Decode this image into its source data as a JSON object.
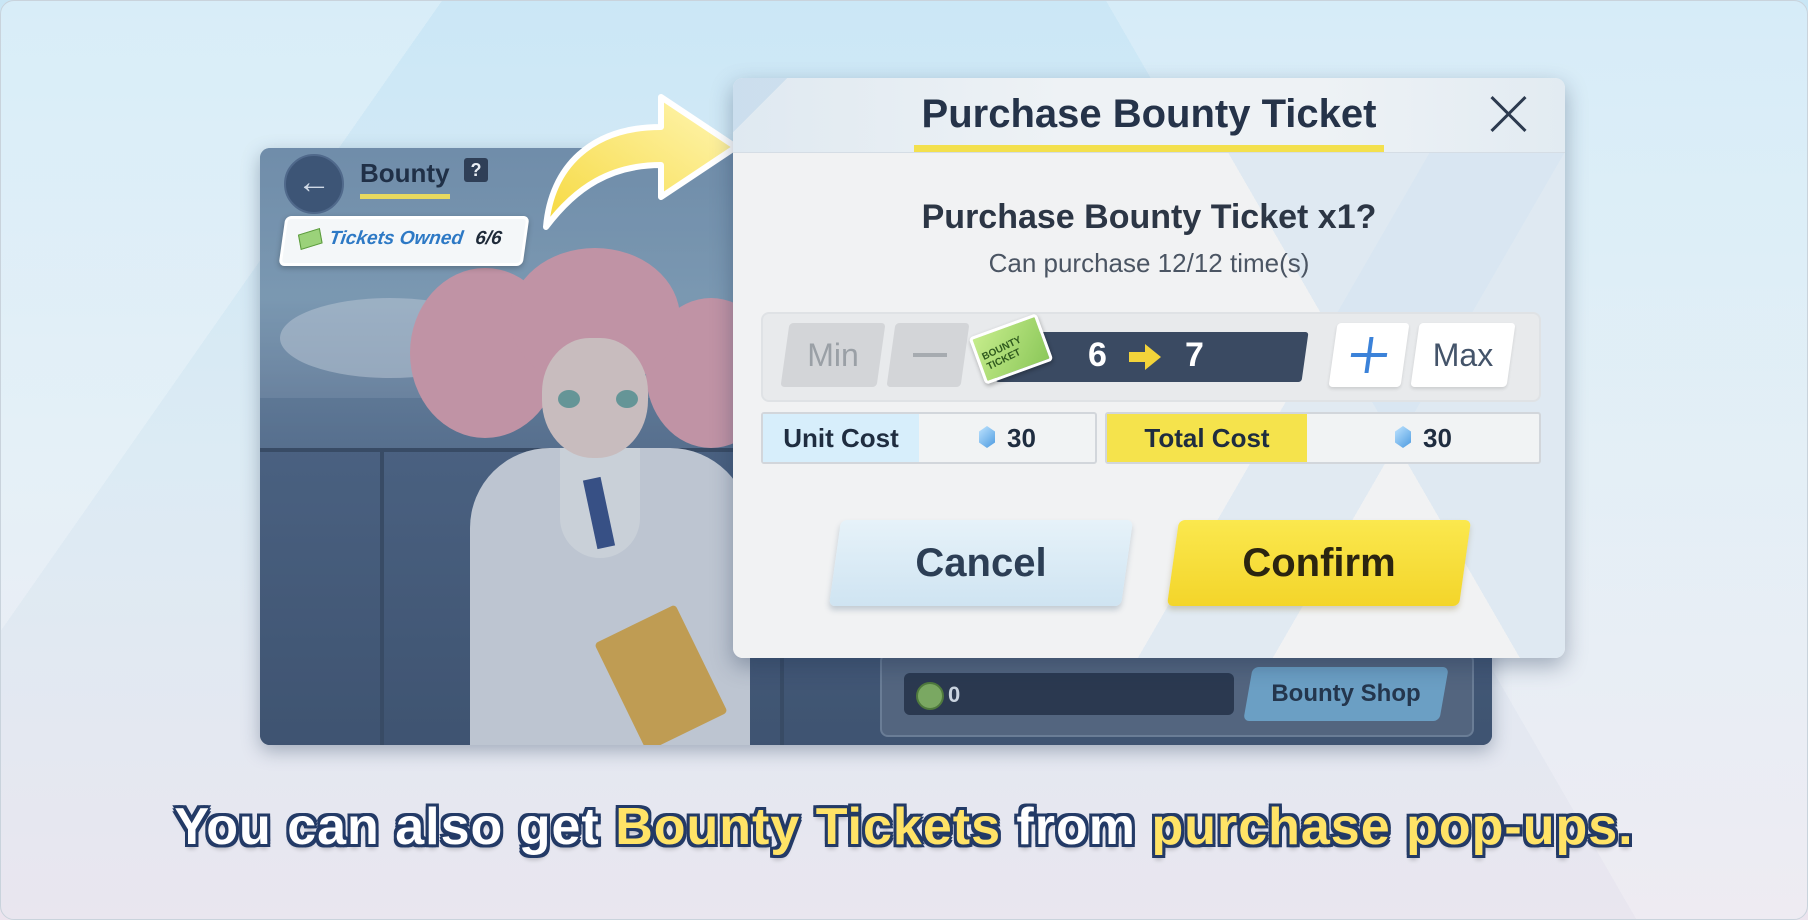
{
  "background_screen": {
    "title": "Bounty",
    "help_icon": "?",
    "back_icon": "arrow-left-icon",
    "tickets_owned_label": "Tickets Owned",
    "tickets_owned_value": "6/6",
    "points_value": "0",
    "bounty_shop_label": "Bounty Shop"
  },
  "popup": {
    "title": "Purchase Bounty Ticket",
    "question": "Purchase Bounty Ticket x1?",
    "purchase_limit": "Can purchase 12/12 time(s)",
    "min_label": "Min",
    "max_label": "Max",
    "ticket_icon_text": "BOUNTY TICKET",
    "count_from": "6",
    "count_to": "7",
    "unit_cost_label": "Unit Cost",
    "unit_cost_value": "30",
    "total_cost_label": "Total Cost",
    "total_cost_value": "30",
    "cancel_label": "Cancel",
    "confirm_label": "Confirm"
  },
  "caption": {
    "part1": "You can also get ",
    "highlight1": "Bounty Tickets",
    "part2": " from ",
    "highlight2": "purchase pop-ups."
  },
  "colors": {
    "accent_yellow": "#f3e04d",
    "confirm_yellow": "#f8de3a",
    "unit_cost_blue": "#d7eefb",
    "caption_outline": "#233a66"
  }
}
